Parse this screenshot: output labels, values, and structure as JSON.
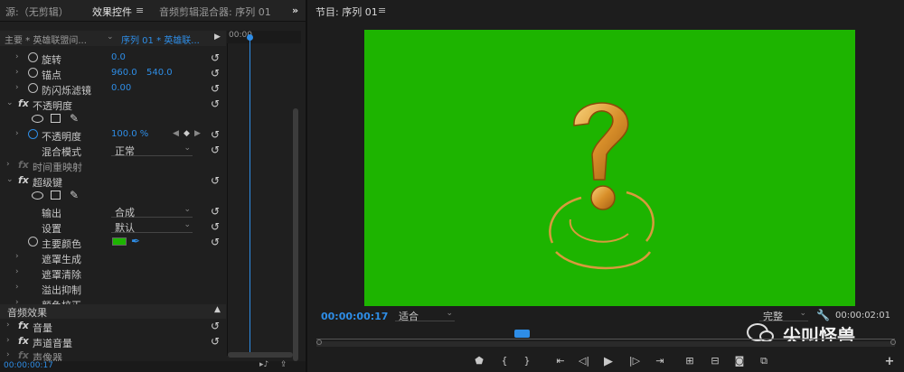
{
  "left_panel": {
    "tabs": [
      "源:（无剪辑）",
      "效果控件",
      "音频剪辑混合器: 序列 01"
    ],
    "tab_menu_glyph": "≡",
    "overflow_glyph": "»",
    "master_clip": "主要 * 英雄联盟间...",
    "sequence_clip": "序列 01 * 英雄联...",
    "ruler_time": "00:00",
    "properties": {
      "rotation": {
        "label": "旋转",
        "value": "0.0"
      },
      "anchor": {
        "label": "锚点",
        "x": "960.0",
        "y": "540.0"
      },
      "flicker": {
        "label": "防闪烁滤镜",
        "value": "0.00"
      },
      "opacity_section": "不透明度",
      "opacity": {
        "label": "不透明度",
        "value": "100.0 %"
      },
      "blend_mode": {
        "label": "混合模式",
        "value": "正常"
      },
      "time_remap": "时间重映射",
      "ultra_key": "超级键",
      "output": {
        "label": "输出",
        "value": "合成"
      },
      "setting": {
        "label": "设置",
        "value": "默认"
      },
      "key_color": {
        "label": "主要颜色",
        "color": "#1db400"
      },
      "matte_gen": "遮罩生成",
      "matte_clean": "遮罩清除",
      "spill": "溢出抑制",
      "color_correct": "颜色校正",
      "audio_effects": "音频效果",
      "volume": "音量",
      "channel_volume": "声道音量",
      "panner": "声像器"
    },
    "timecode": "00:00:00:17"
  },
  "program": {
    "title": "节目: 序列 01",
    "menu_glyph": "≡",
    "timecode": "00:00:00:17",
    "fit": "适合",
    "quality": "完整",
    "duration": "00:00:02:01",
    "watermark": "尖叫怪兽",
    "accent": "#2e8de6",
    "green": "#1db400"
  }
}
